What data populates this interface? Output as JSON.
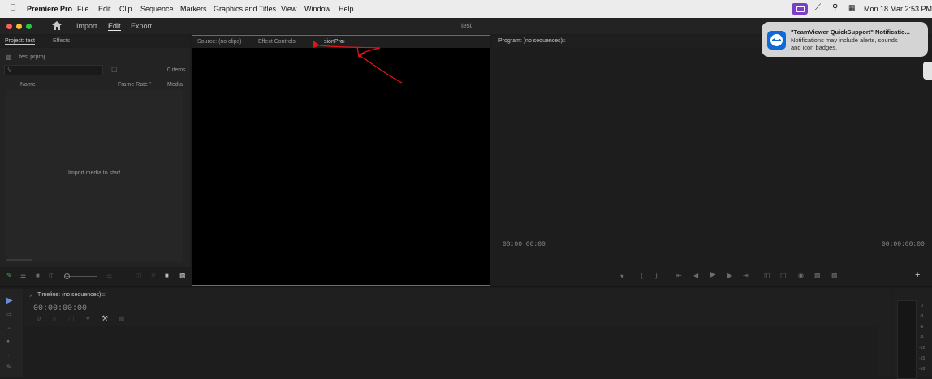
{
  "menubar": {
    "apple_icon": "apple-icon",
    "items": [
      "Premiere Pro",
      "File",
      "Edit",
      "Clip",
      "Sequence",
      "Markers",
      "Graphics and Titles",
      "View",
      "Window",
      "Help"
    ],
    "datetime": "Mon 18 Mar  2:53 PM"
  },
  "app": {
    "nav": [
      "Import",
      "Edit",
      "Export"
    ],
    "active_nav": "Edit",
    "doc_title": "test"
  },
  "project": {
    "tab_project": "Project: test",
    "tab_effects": "Effects",
    "file": "test.prproj",
    "item_count": "0 items",
    "columns": [
      "Name",
      "Frame Rate",
      "Media"
    ],
    "empty_message": "Import media to start"
  },
  "source": {
    "tabs": [
      "Source: (no clips)",
      "Effect Controls",
      "sionPro"
    ]
  },
  "program": {
    "tab": "Program: (no sequences)",
    "timecode_left": "00:00:00:00",
    "timecode_right": "00:00:00:00"
  },
  "timeline": {
    "tab": "Timeline: (no sequences)",
    "timecode": "00:00:00:00"
  },
  "meter": {
    "ticks": [
      "0",
      "-3",
      "-6",
      "-9",
      "-12",
      "-15",
      "-18"
    ]
  },
  "notification": {
    "title": "\"TeamViewer QuickSupport\" Notificatio...",
    "body_line1": "Notifications may include alerts, sounds",
    "body_line2": "and icon badges."
  },
  "colors": {
    "accent_purple": "#6e56d6",
    "annotation_red": "#e0151b",
    "traffic_red": "#ff5f57",
    "traffic_yellow": "#febc2e",
    "traffic_green": "#28c840",
    "teamviewer_blue": "#0e6ad6"
  }
}
